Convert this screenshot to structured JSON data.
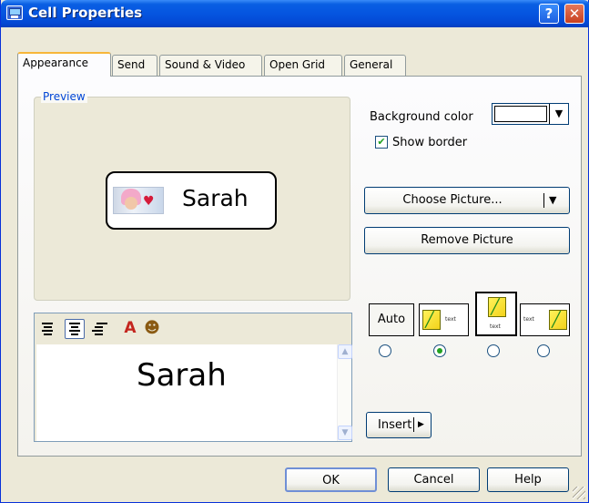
{
  "window": {
    "title": "Cell Properties"
  },
  "tabs": [
    {
      "label": "Appearance"
    },
    {
      "label": "Send"
    },
    {
      "label": "Sound & Video"
    },
    {
      "label": "Open Grid"
    },
    {
      "label": "General"
    }
  ],
  "preview": {
    "label": "Preview",
    "cell_text": "Sarah"
  },
  "editor": {
    "text": "Sarah"
  },
  "background": {
    "label": "Background color",
    "color": "#ffffff"
  },
  "show_border": {
    "label": "Show border",
    "checked": true
  },
  "buttons": {
    "choose_picture": "Choose Picture...",
    "remove_picture": "Remove Picture",
    "insert": "Insert",
    "ok": "OK",
    "cancel": "Cancel",
    "help": "Help"
  },
  "layout": {
    "auto_label": "Auto",
    "text_label": "text",
    "selected_index": 1
  },
  "icons": [
    "help-icon",
    "close-icon",
    "align-left-icon",
    "align-center-icon",
    "align-right-icon",
    "font-icon",
    "color-palette-icon"
  ]
}
